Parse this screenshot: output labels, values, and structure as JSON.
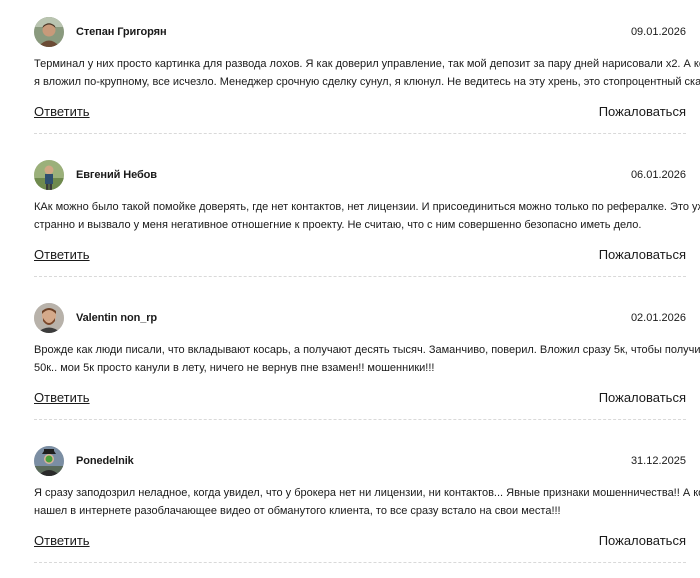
{
  "comments": [
    {
      "author": "Степан Григорян",
      "date": "09.01.2026",
      "avatar": "avatar-photo-man-brown",
      "text_lines": [
        "Терминал у них просто картинка для развода лохов. Я как доверил управление, так мой депозит за пару дней нарисовали х2. А когда",
        "я вложил по-крупному, все исчезло. Менеджер срочную сделку сунул, я клюнул. Не ведитесь на эту хрень, это стопроцентный скам."
      ],
      "reply_label": "Ответить",
      "report_label": "Пожаловаться"
    },
    {
      "author": "Евгений Небов",
      "date": "06.01.2026",
      "avatar": "avatar-photo-outdoor",
      "text_lines": [
        "КАк можно было такой помойке доверять, где нет контактов, нет лицензии. И присоединиться можно только по рефералке. Это уже",
        "странно и вызвало у меня негативное отношегние к проекту. Не считаю, что с ним совершенно безопасно иметь дело."
      ],
      "reply_label": "Ответить",
      "report_label": "Пожаловаться"
    },
    {
      "author": "Valentin non_rp",
      "date": "02.01.2026",
      "avatar": "avatar-photo-bearded-man",
      "text_lines": [
        "Врожде как люди писали, что вкладывают косарь, а получают десять тысяч. Заманчиво, поверил. Вложил сразу 5к, чтобы получить",
        "50к.. мои 5к просто канули в лету, ничего не вернув пне взамен!! мошенники!!!"
      ],
      "reply_label": "Ответить",
      "report_label": "Пожаловаться"
    },
    {
      "author": "Ponedelnik",
      "date": "31.12.2025",
      "avatar": "avatar-son-of-man-apple",
      "text_lines": [
        "Я сразу заподозрил неладное, когда увидел, что у брокера нет ни лицензии, ни контактов... Явные признаки мошенничества!! А когда",
        "нашел в интернете разоблачающее видео от обманутого клиента, то все сразу встало на свои места!!!"
      ],
      "reply_label": "Ответить",
      "report_label": "Пожаловаться"
    }
  ]
}
